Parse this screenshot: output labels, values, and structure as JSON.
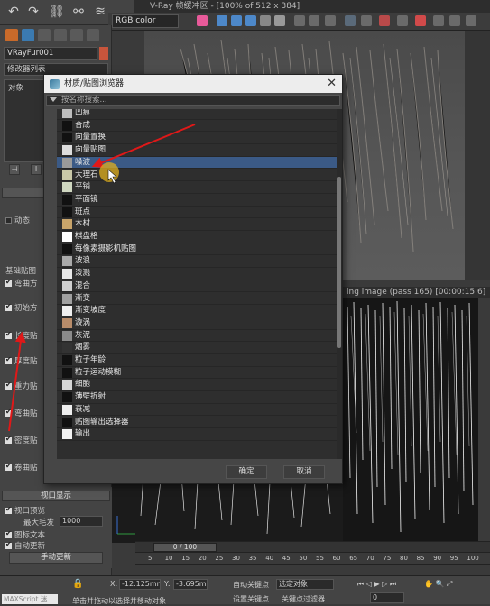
{
  "vfb": {
    "title": "V-Ray 帧缓冲区 - [100% of 512 x 384]",
    "channel": "RGB color",
    "render_title": "ing image (pass 165) [00:00:15.6]"
  },
  "panel": {
    "object_name": "VRayFur001",
    "modifier_list": "修改器列表",
    "stack_label": "对象",
    "rollout_basic": "基础贴图",
    "dynamic_label": "动态",
    "options": [
      "弯曲方",
      "初始方",
      "长度贴",
      "厚度贴",
      "重力贴",
      "弯曲贴",
      "密度贴",
      "卷曲贴"
    ],
    "viewport_rollout": "视口显示",
    "viewport_preview": "视口预览",
    "max_hairs_label": "最大毛发",
    "max_hairs_value": "1000",
    "icon_text": "图标文本",
    "auto_update": "自动更新",
    "manual_update": "手动更新"
  },
  "dialog": {
    "title": "材质/贴图浏览器",
    "search_placeholder": "按名称搜索...",
    "items": [
      {
        "label": "凹痕",
        "icon": "dent-icon",
        "color": "#bdbdbd"
      },
      {
        "label": "合成",
        "icon": "composite-icon",
        "color": "#111111"
      },
      {
        "label": "向量置换",
        "icon": "vector-displacement-icon",
        "color": "#111111"
      },
      {
        "label": "向量贴图",
        "icon": "vector-map-icon",
        "color": "#dddddd"
      },
      {
        "label": "噪波",
        "icon": "noise-icon",
        "color": "#9a9a9a"
      },
      {
        "label": "大理石",
        "icon": "marble-icon",
        "color": "#c9c8a8"
      },
      {
        "label": "平铺",
        "icon": "tiles-icon",
        "color": "#cfd7c0"
      },
      {
        "label": "平面镜",
        "icon": "flat-mirror-icon",
        "color": "#111111"
      },
      {
        "label": "斑点",
        "icon": "speckle-icon",
        "color": "#111111"
      },
      {
        "label": "木材",
        "icon": "wood-icon",
        "color": "#c8a46a"
      },
      {
        "label": "棋盘格",
        "icon": "checker-icon",
        "color": "#ffffff"
      },
      {
        "label": "每像素摄影机贴图",
        "icon": "camera-map-icon",
        "color": "#111111"
      },
      {
        "label": "波浪",
        "icon": "waves-icon",
        "color": "#aaaaaa"
      },
      {
        "label": "泼溅",
        "icon": "splat-icon",
        "color": "#e8e8e8"
      },
      {
        "label": "混合",
        "icon": "mix-icon",
        "color": "#cfcfcf"
      },
      {
        "label": "渐变",
        "icon": "gradient-icon",
        "color": "#a0a0a0"
      },
      {
        "label": "渐变坡度",
        "icon": "gradient-ramp-icon",
        "color": "#efefef"
      },
      {
        "label": "漩涡",
        "icon": "swirl-icon",
        "color": "#b88c6a"
      },
      {
        "label": "灰泥",
        "icon": "stucco-icon",
        "color": "#8a8a8a"
      },
      {
        "label": "烟雾",
        "icon": "smoke-icon",
        "color": "#333333"
      },
      {
        "label": "粒子年龄",
        "icon": "particle-age-icon",
        "color": "#111111"
      },
      {
        "label": "粒子运动模糊",
        "icon": "particle-mblur-icon",
        "color": "#111111"
      },
      {
        "label": "细胞",
        "icon": "cellular-icon",
        "color": "#d6d6d6"
      },
      {
        "label": "薄壁折射",
        "icon": "thin-wall-refraction-icon",
        "color": "#111111"
      },
      {
        "label": "衰减",
        "icon": "falloff-icon",
        "color": "#eeeeee"
      },
      {
        "label": "贴图输出选择器",
        "icon": "output-selector-icon",
        "color": "#111111"
      },
      {
        "label": "输出",
        "icon": "output-icon",
        "color": "#f2f2f2"
      }
    ],
    "selected_index": 4,
    "ok_label": "确定",
    "cancel_label": "取消"
  },
  "timeline": {
    "frame": "0 / 100",
    "ticks": [
      "5",
      "10",
      "15",
      "20",
      "25",
      "30",
      "35",
      "40",
      "45",
      "50",
      "55",
      "60",
      "65",
      "70",
      "75",
      "80",
      "85",
      "90",
      "95",
      "100"
    ]
  },
  "status": {
    "x_label": "X:",
    "x_value": "-12.125mm",
    "y_label": "Y:",
    "y_value": "-3.695m",
    "auto_key": "自动关键点",
    "selected_object": "选定对象",
    "set_key": "设置关键点",
    "key_filter": "关键点过滤器...",
    "frame_value": "0",
    "prompt": "单击并拖动以选择并移动对象",
    "maxscript": "MAXScript 迷"
  },
  "colors": {
    "selection": "#3b5a86",
    "annotation": "#e01818",
    "cursor_highlight": "#e0b020"
  }
}
